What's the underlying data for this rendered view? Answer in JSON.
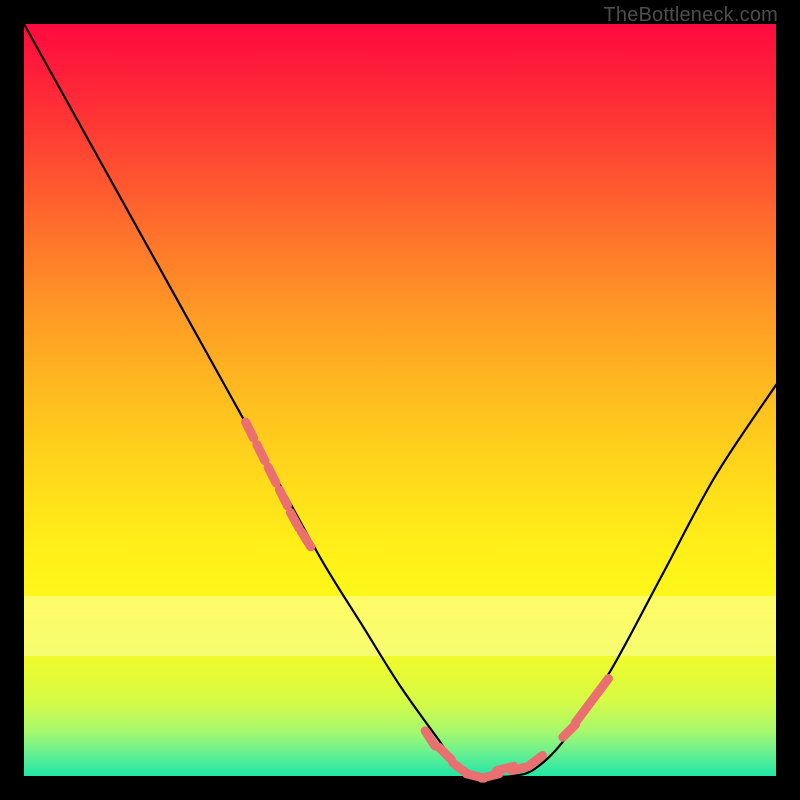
{
  "attribution": "TheBottleneck.com",
  "chart_data": {
    "type": "line",
    "title": "",
    "xlabel": "",
    "ylabel": "",
    "xlim": [
      0,
      100
    ],
    "ylim": [
      0,
      100
    ],
    "series": [
      {
        "name": "bottleneck-curve",
        "x": [
          0,
          5,
          10,
          15,
          20,
          25,
          30,
          35,
          40,
          45,
          50,
          55,
          58,
          62,
          65,
          68,
          72,
          78,
          85,
          92,
          100
        ],
        "values": [
          100,
          91,
          82,
          73,
          64,
          55,
          46,
          37,
          28,
          20,
          12,
          5,
          1,
          0,
          0,
          1,
          5,
          14,
          27,
          40,
          52
        ]
      }
    ],
    "markers": {
      "name": "highlight-dots",
      "color": "#e96f71",
      "x": [
        30,
        31.5,
        33,
        34.5,
        36,
        37.5,
        54,
        56,
        58,
        60,
        62,
        64,
        66,
        68,
        72.5,
        74,
        75.5,
        77
      ],
      "values": [
        46,
        43,
        40,
        37,
        34,
        31.5,
        5,
        3,
        1,
        0,
        0,
        1,
        1,
        2,
        6,
        8,
        10,
        12
      ]
    },
    "background_gradient": {
      "top": "#ff0a40",
      "bottom": "#20e6a6"
    }
  }
}
